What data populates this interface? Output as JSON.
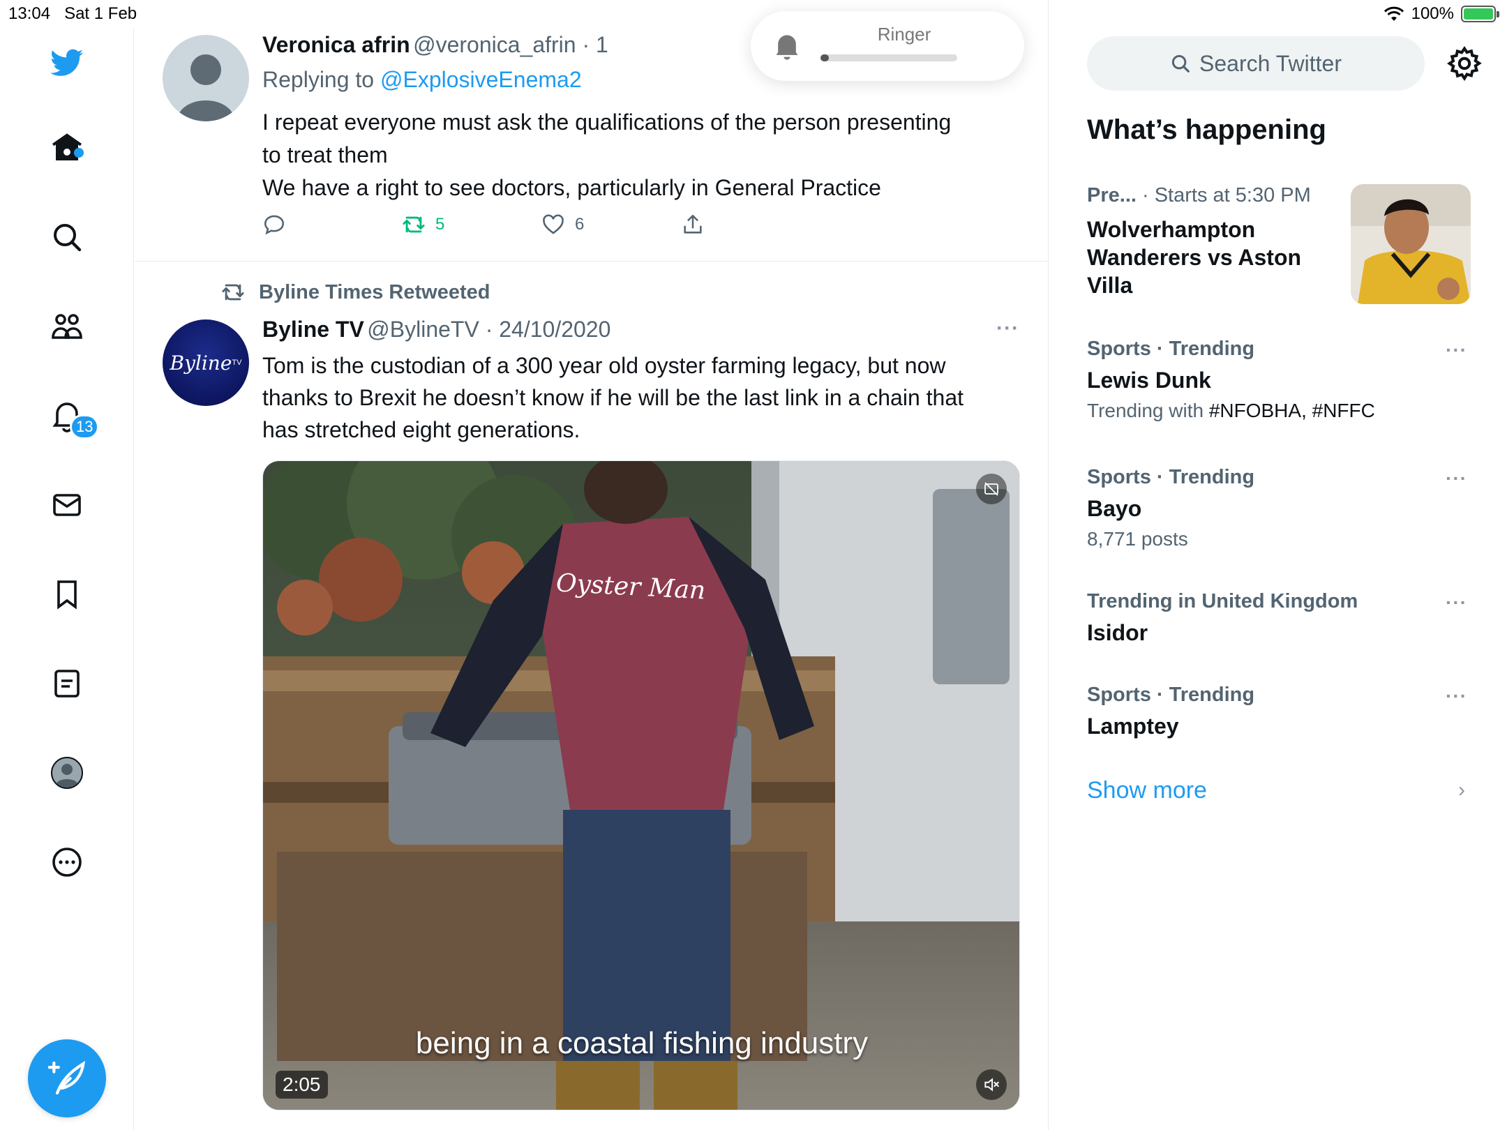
{
  "status_bar": {
    "time": "13:04",
    "date": "Sat 1 Feb",
    "battery": "100%",
    "battery_level": 1.0
  },
  "left_nav": {
    "notifications_count": "13",
    "icons": [
      "twitter-logo-icon",
      "home-icon",
      "search-icon",
      "communities-icon",
      "notifications-icon",
      "messages-icon",
      "bookmarks-icon",
      "lists-icon",
      "profile-icon",
      "more-icon",
      "compose-icon"
    ]
  },
  "ringer": {
    "label": "Ringer",
    "level": 0.05
  },
  "tweet1": {
    "name": "Veronica afrin",
    "handle": "@veronica_afrin · 1",
    "replying_prefix": "Replying to ",
    "replying_to": "@ExplosiveEnema2",
    "body_lines": [
      "I repeat everyone must ask the qualifications of the person presenting",
      "to treat them",
      "We have a right to see doctors, particularly in General Practice"
    ],
    "retweets": "5",
    "likes": "6",
    "more": "···"
  },
  "tweet2": {
    "retweeted_by": "Byline Times Retweeted",
    "name": "Byline TV",
    "handle": "@BylineTV · 24/10/2020",
    "avatar_text": "Byline",
    "avatar_sup": "TV",
    "body_lines": [
      "Tom is the custodian of a 300 year old oyster farming legacy, but now",
      "thanks to Brexit he doesn’t know if he will be the last link in a chain that",
      "has stretched eight generations."
    ],
    "video": {
      "shirt_text": "Oyster Man",
      "caption": "being in a coastal fishing industry",
      "duration": "2:05"
    },
    "more": "···"
  },
  "sidebar": {
    "search_placeholder": "Search Twitter",
    "whats_happening": "What’s happening",
    "event": {
      "category": "Pre...",
      "time": "· Starts at 5:30 PM",
      "title_lines": [
        "Wolverhampton",
        "Wanderers vs Aston",
        "Villa"
      ]
    },
    "trends": [
      {
        "category": "Sports · Trending",
        "name": "Lewis Dunk",
        "sub_prefix": "Trending with ",
        "sub_highlight": "#NFOBHA, #NFFC"
      },
      {
        "category": "Sports · Trending",
        "name": "Bayo",
        "sub": "8,771 posts"
      },
      {
        "category": "Trending in United Kingdom",
        "name": "Isidor"
      },
      {
        "category": "Sports · Trending",
        "name": "Lamptey"
      }
    ],
    "show_more": "Show more",
    "more": "···",
    "chevron": "›"
  },
  "colors": {
    "accent": "#1d9bf0",
    "retweet_green": "#00ba7c",
    "text_primary": "#0f1419",
    "text_secondary": "#536471"
  }
}
